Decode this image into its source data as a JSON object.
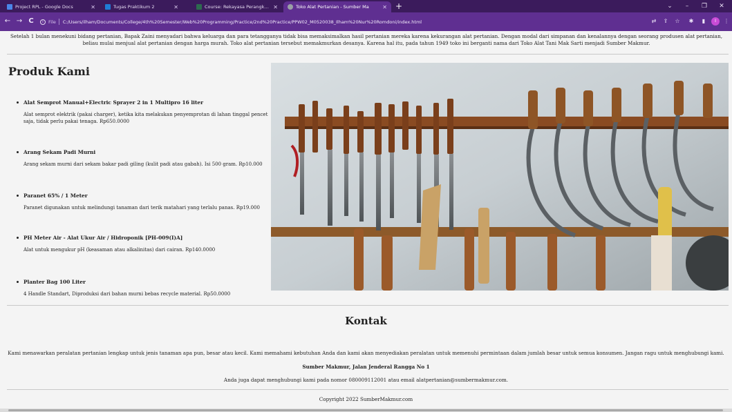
{
  "browser": {
    "tabs": [
      {
        "title": "Project RPL - Google Docs",
        "icon_color": "#4a86e8",
        "active": false
      },
      {
        "title": "Tugas Praktikum 2",
        "icon_color": "#1f7cd6",
        "active": false
      },
      {
        "title": "Course: Rekayasa Perangkat Luna",
        "icon_color": "#2d6a4f",
        "active": false
      },
      {
        "title": "Toko Alat Pertanian - Sumber Ma",
        "icon_color": "#9aa0a6",
        "active": true
      }
    ],
    "new_tab_label": "+",
    "address": {
      "file_label": "File",
      "url": "C:/Users/ilham/Documents/College/4th%20Semester/Web%20Programming/Practice/2nd%20Practice/PPW02_M0520038_Ilham%20Nur%20Romdoni/index.html"
    },
    "colors": {
      "tabbar": "#3b1b5c",
      "toolbar": "#5f2f91"
    }
  },
  "page": {
    "intro": "Setelah 1 bulan menekuni bidang pertanian, Bapak Zaini menyadari bahwa keluarga dan para tetangganya tidak bisa memaksimalkan hasil pertanian mereka karena kekurangan alat pertanian. Dengan modal dari simpanan dan kenalannya dengan seorang produsen alat pertanian, beliau mulai menjual alat pertanian dengan harga murah. Toko alat pertanian tersebut memakmurkan desanya. Karena hal itu, pada tahun 1949 toko ini berganti nama dari Toko Alat Tani Mak Sarti menjadi Sumber Makmur.",
    "produk_heading": "Produk Kami",
    "products": [
      {
        "name": "Alat Semprot Manual+Electric Sprayer 2 in 1 Multipro 16 liter",
        "description": "Alat semprot elektrik (pakai charger), ketika kita melakukan penyemprotan di lahan tinggal pencet saja, tidak perlu pakai tenaga. Rp650.0000"
      },
      {
        "name": "Arang Sekam Padi Murni",
        "description": "Arang sekam murni dari sekam bakar padi giling (kulit padi atau gabah). Isi 500 gram. Rp10.000"
      },
      {
        "name": "Paranet 65% / 1 Meter",
        "description": "Paranet digunakan untuk melindungi tanaman dari terik matahari yang terlalu panas. Rp19.000"
      },
      {
        "name": "PH Meter Air - Alat Ukur Air / Hidroponik [PH-009(I)A]",
        "description": "Alat untuk mengukur pH (keasaman atau alkalinitas) dari cairan. Rp140.0000"
      },
      {
        "name": "Planter Bag 100 Liter",
        "description": "4 Handle Standart, Diproduksi dari bahan murni bebas recycle material. Rp50.0000"
      }
    ],
    "kontak_heading": "Kontak",
    "kontak_text": "Kami menawarkan peralatan pertanian lengkap untuk jenis tanaman apa pun, besar atau kecil. Kami memahami kebutuhan Anda dan kami akan menyediakan peralatan untuk memenuhi permintaan dalam jumlah besar untuk semua konsumen. Jangan ragu untuk menghubungi kami.",
    "address": "Sumber Makmur, Jalan Jenderal Rangga No 1",
    "contact_line": "Anda juga dapat menghubungi kami pada nomor 080009112001 atau email alatpertanian@sumbermakmur.com.",
    "copyright": "Copyright 2022 SumberMakmur.com"
  }
}
